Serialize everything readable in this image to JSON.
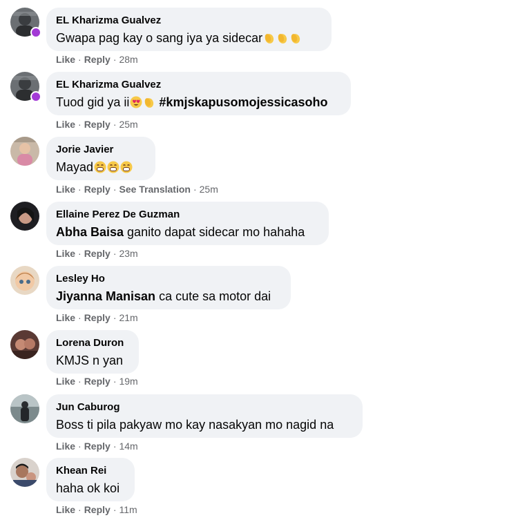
{
  "comments": [
    {
      "author": "EL Kharizma Gualvez",
      "text_before": "Gwapa pag kay o sang iya ya sidecar",
      "emojis": [
        "clap",
        "clap",
        "clap"
      ],
      "like": "Like",
      "reply": "Reply",
      "time": "28m"
    },
    {
      "author": "EL Kharizma Gualvez",
      "text_before": "Tuod gid ya ii",
      "emojis": [
        "heart-eyes",
        "clap"
      ],
      "hashtag": "#kmjskapusomojessicasoho",
      "like": "Like",
      "reply": "Reply",
      "time": "25m"
    },
    {
      "author": "Jorie Javier",
      "text_before": "Mayad",
      "emojis": [
        "grin",
        "grin",
        "grin"
      ],
      "like": "Like",
      "reply": "Reply",
      "translate": "See Translation",
      "time": "25m"
    },
    {
      "author": "Ellaine Perez De Guzman",
      "mention": "Abha Baisa",
      "text_after": " ganito dapat sidecar mo hahaha",
      "like": "Like",
      "reply": "Reply",
      "time": "23m"
    },
    {
      "author": "Lesley Ho",
      "mention": "Jiyanna Manisan",
      "text_after": " ca cute sa motor dai",
      "like": "Like",
      "reply": "Reply",
      "time": "21m"
    },
    {
      "author": "Lorena Duron",
      "text_before": "KMJS n yan",
      "like": "Like",
      "reply": "Reply",
      "time": "19m"
    },
    {
      "author": "Jun Caburog",
      "text_before": "Boss ti pila pakyaw mo kay nasakyan mo nagid na",
      "like": "Like",
      "reply": "Reply",
      "time": "14m"
    },
    {
      "author": "Khean Rei",
      "text_before": "haha ok koi",
      "like": "Like",
      "reply": "Reply",
      "time": "11m"
    }
  ],
  "colors": {
    "bubble": "#f0f2f5",
    "text": "#050505",
    "meta": "#65676b",
    "status": "#a33ad6"
  }
}
